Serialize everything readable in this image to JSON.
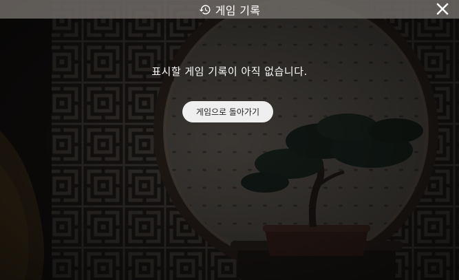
{
  "window": {
    "title": "게임 기록",
    "title_icon": "history-icon",
    "close_icon": "close-icon"
  },
  "main": {
    "empty_message": "표시할 게임 기록이 아직 없습니다.",
    "back_button_label": "게임으로 돌아가기"
  },
  "colors": {
    "titlebar": "#6e6a66",
    "button_bg": "#efefef",
    "text": "#ffffff"
  }
}
